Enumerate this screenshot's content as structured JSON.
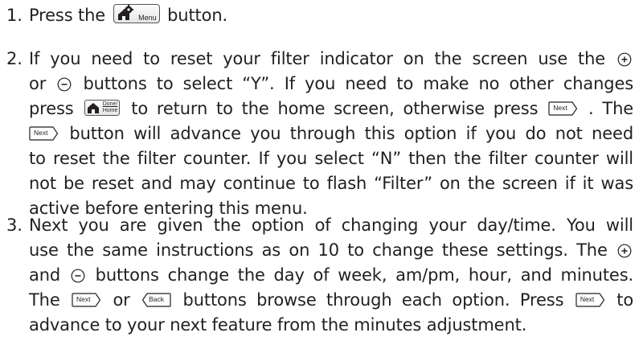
{
  "steps": [
    {
      "number": "1.",
      "lines": [
        {
          "before": "Press the",
          "icon": "menu",
          "after": "button."
        }
      ]
    },
    {
      "number": "2.",
      "lines": [
        {
          "t1": "If you need to reset your filter indicator on the screen use the"
        },
        {
          "t2": "or",
          "t3": "buttons to select “Y”. If you need to make no other changes"
        },
        {
          "t4": "press",
          "t5": "to return to the home screen, otherwise press",
          "t6": ". The"
        },
        {
          "t7": "button will advance you through this option if you do not need"
        },
        {
          "t8": "to reset the filter counter. If you select “N” then the filter counter will"
        },
        {
          "t9": "not be reset and may continue to flash “Filter” on the screen if it was"
        },
        {
          "t10": "active before entering this menu."
        }
      ]
    },
    {
      "number": "3.",
      "lines": [
        {
          "t1": "Next you are given the option of changing your day/time. You will"
        },
        {
          "t2": "use the same instructions as on 10 to change these settings. The"
        },
        {
          "t3": "and",
          "t4": "buttons change the day of week, am/pm, hour, and minutes."
        },
        {
          "t5": "The",
          "t6": "or",
          "t7": "buttons browse through each option. Press",
          "t8": "to"
        },
        {
          "t9": "advance to your next feature from the minutes adjustment."
        }
      ]
    }
  ],
  "icons": {
    "menu_label": "Menu",
    "home_label_top": "Done/",
    "home_label_bottom": "Home",
    "next_label": "Next",
    "back_label": "Back"
  }
}
